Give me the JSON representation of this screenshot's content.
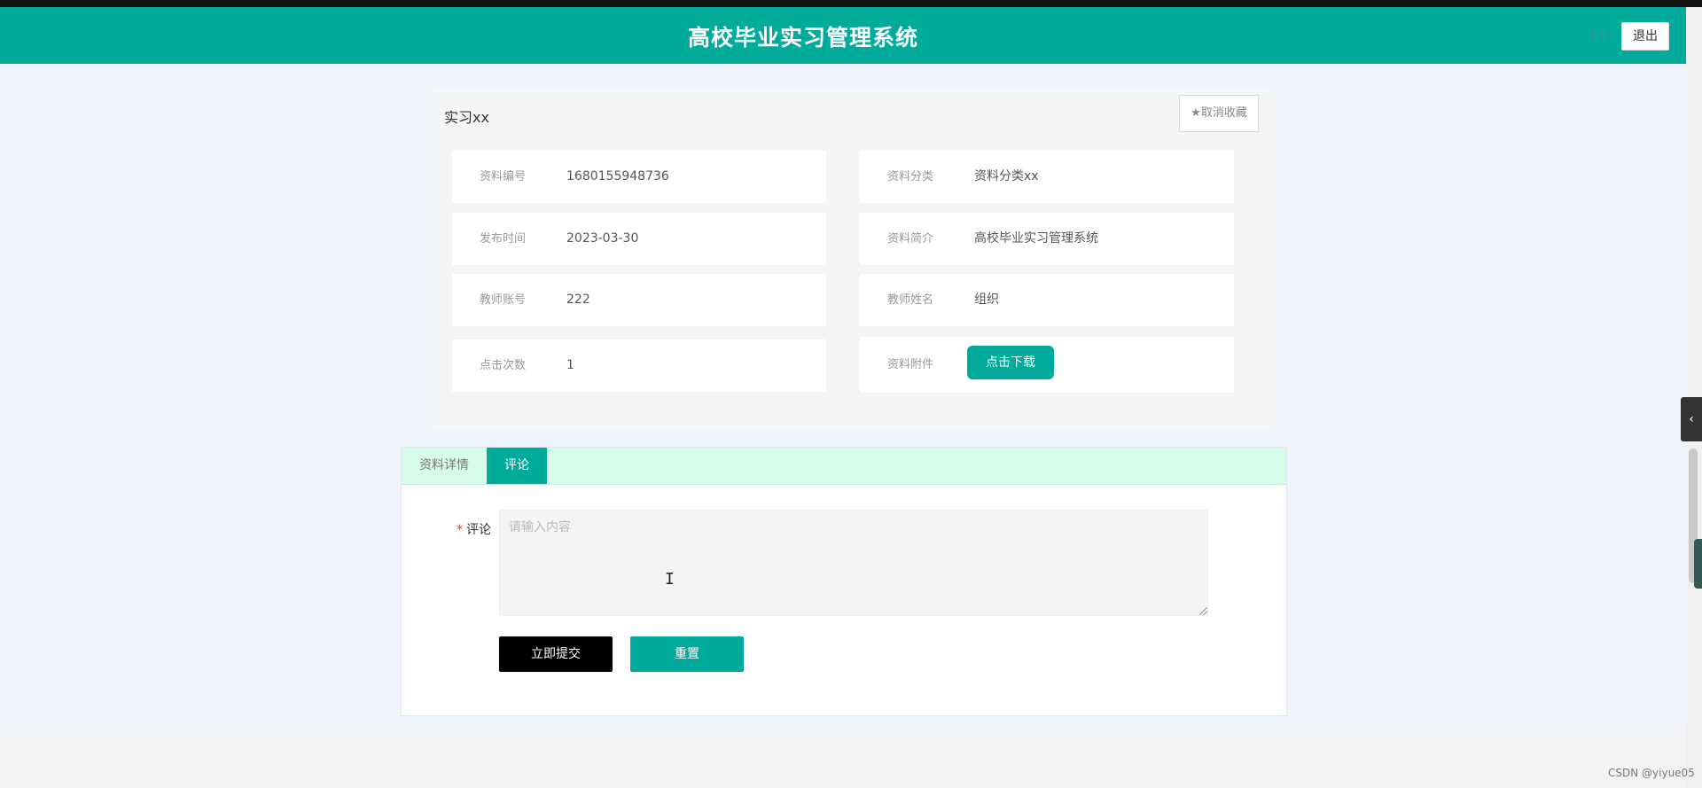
{
  "header": {
    "title": "高校毕业实习管理系统",
    "user": "111",
    "logout_label": "退出"
  },
  "detail": {
    "name": "实习xx",
    "fav_label": "★取消收藏",
    "fields": [
      {
        "label": "资料编号",
        "value": "1680155948736"
      },
      {
        "label": "资料分类",
        "value": "资料分类xx"
      },
      {
        "label": "发布时间",
        "value": "2023-03-30"
      },
      {
        "label": "资料简介",
        "value": "高校毕业实习管理系统"
      },
      {
        "label": "教师账号",
        "value": "222"
      },
      {
        "label": "教师姓名",
        "value": "组织"
      },
      {
        "label": "点击次数",
        "value": "1"
      },
      {
        "label": "资料附件",
        "value": ""
      }
    ],
    "download_label": "点击下载"
  },
  "tabs": [
    {
      "label": "资料详情",
      "active": false
    },
    {
      "label": "评论",
      "active": true
    }
  ],
  "comment_form": {
    "required_mark": "*",
    "label": "评论",
    "value": "",
    "placeholder": "请输入内容",
    "submit_label": "立即提交",
    "reset_label": "重置"
  },
  "side_toggle_icon": "chevron-left-icon",
  "watermark": "CSDN @yiyue05",
  "colors": {
    "primary": "#00ab9b",
    "tab_bar": "#d6fbe9",
    "page_bg": "#eef3fc"
  }
}
